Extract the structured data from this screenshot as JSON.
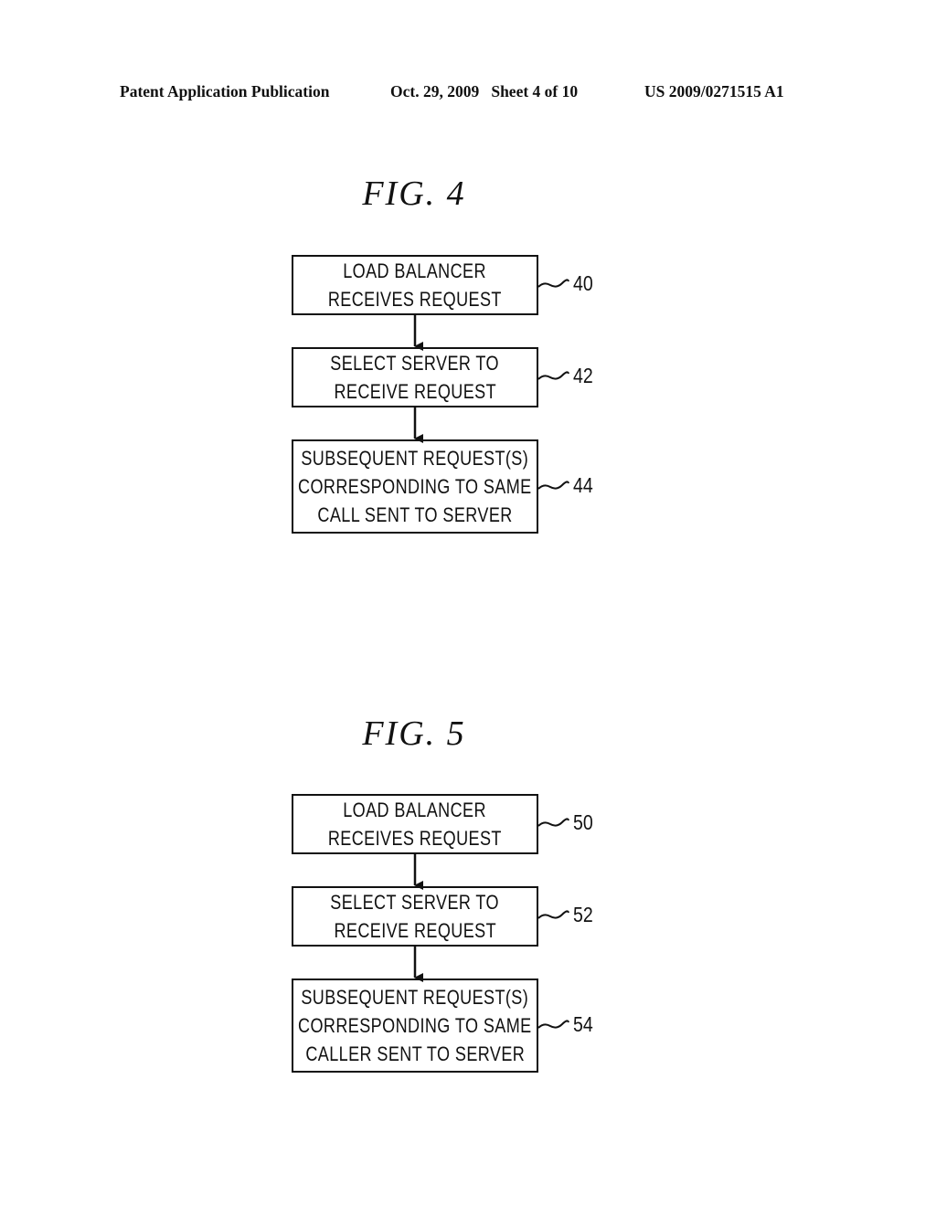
{
  "header": {
    "left": "Patent Application Publication",
    "date_sheet": "Oct. 29, 2009   Sheet 4 of 10",
    "number": "US 2009/0271515 A1"
  },
  "figures": [
    {
      "title": "FIG.  4",
      "steps": [
        {
          "ref": "40",
          "lines": [
            "LOAD BALANCER",
            "RECEIVES REQUEST"
          ]
        },
        {
          "ref": "42",
          "lines": [
            "SELECT SERVER TO",
            "RECEIVE REQUEST"
          ]
        },
        {
          "ref": "44",
          "lines": [
            "SUBSEQUENT REQUEST(S)",
            "CORRESPONDING TO SAME",
            "CALL SENT TO SERVER"
          ]
        }
      ]
    },
    {
      "title": "FIG.  5",
      "steps": [
        {
          "ref": "50",
          "lines": [
            "LOAD BALANCER",
            "RECEIVES REQUEST"
          ]
        },
        {
          "ref": "52",
          "lines": [
            "SELECT SERVER TO",
            "RECEIVE REQUEST"
          ]
        },
        {
          "ref": "54",
          "lines": [
            "SUBSEQUENT REQUEST(S)",
            "CORRESPONDING TO SAME",
            "CALLER SENT TO SERVER"
          ]
        }
      ]
    }
  ]
}
